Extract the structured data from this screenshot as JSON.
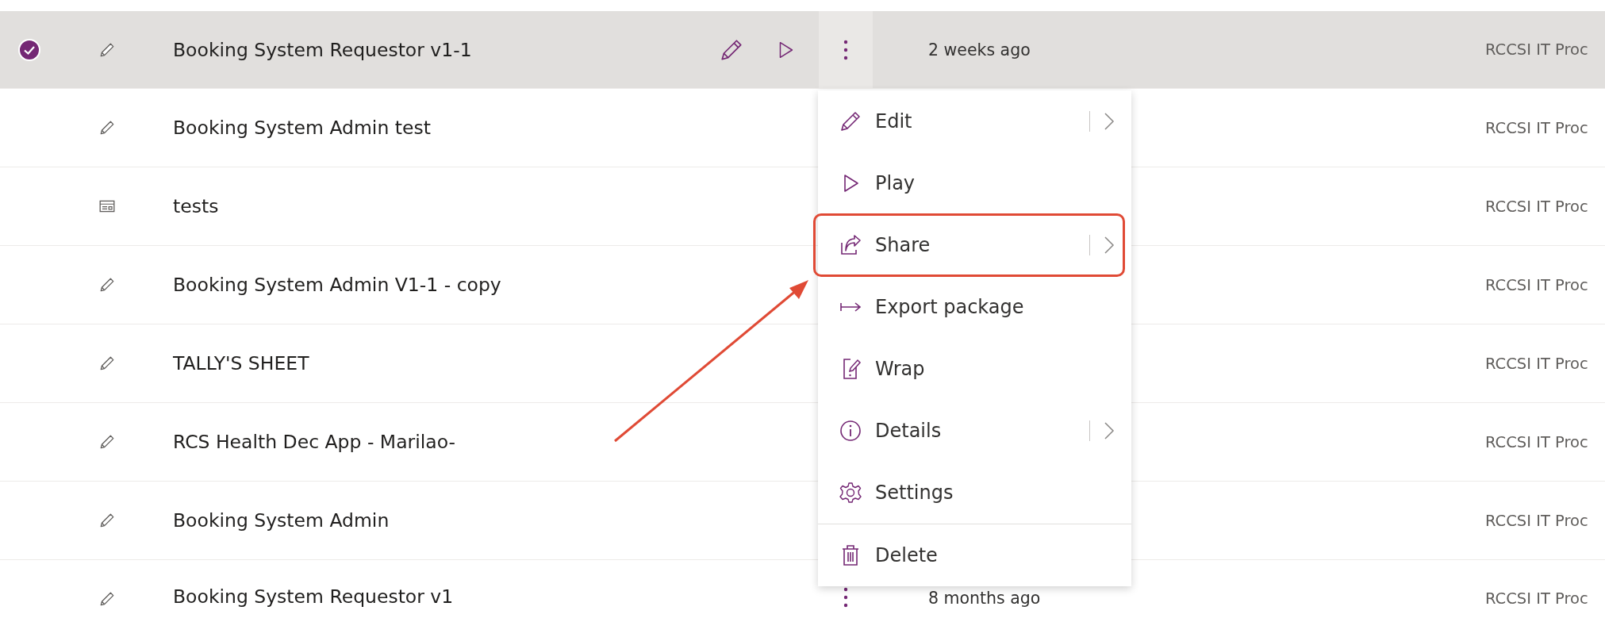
{
  "rows": [
    {
      "name": "Booking System Requestor v1-1",
      "kind": "canvas",
      "selected": true,
      "hovered": true,
      "show_more": true,
      "modified": "2 weeks ago",
      "owner": "RCCSI IT Proc"
    },
    {
      "name": "Booking System Admin test",
      "kind": "canvas",
      "selected": false,
      "hovered": false,
      "show_more": false,
      "owner": "RCCSI IT Proc"
    },
    {
      "name": "tests",
      "kind": "form",
      "selected": false,
      "hovered": false,
      "show_more": false,
      "owner": "RCCSI IT Proc"
    },
    {
      "name": "Booking System Admin V1-1 - copy",
      "kind": "canvas",
      "selected": false,
      "hovered": false,
      "show_more": false,
      "owner": "RCCSI IT Proc"
    },
    {
      "name": "TALLY'S SHEET",
      "kind": "canvas",
      "selected": false,
      "hovered": false,
      "show_more": false,
      "owner": "RCCSI IT Proc"
    },
    {
      "name": "RCS Health Dec App - Marilao-",
      "kind": "canvas",
      "selected": false,
      "hovered": false,
      "show_more": false,
      "owner": "RCCSI IT Proc"
    },
    {
      "name": "Booking System Admin",
      "kind": "canvas",
      "selected": false,
      "hovered": false,
      "show_more": false,
      "owner": "RCCSI IT Proc"
    },
    {
      "name": "Booking System Requestor v1",
      "kind": "canvas",
      "selected": false,
      "hovered": false,
      "show_more": true,
      "modified": "8 months ago",
      "owner": "RCCSI IT Proc"
    }
  ],
  "context_menu": {
    "items": [
      {
        "label": "Edit",
        "kind": "pencil",
        "submenu": true,
        "highlighted": false,
        "divider_before": false
      },
      {
        "label": "Play",
        "kind": "play",
        "submenu": false,
        "highlighted": false,
        "divider_before": false
      },
      {
        "label": "Share",
        "kind": "share",
        "submenu": true,
        "highlighted": true,
        "divider_before": false
      },
      {
        "label": "Export package",
        "kind": "export",
        "submenu": false,
        "highlighted": false,
        "divider_before": false
      },
      {
        "label": "Wrap",
        "kind": "wrap",
        "submenu": false,
        "highlighted": false,
        "divider_before": false
      },
      {
        "label": "Details",
        "kind": "info",
        "submenu": true,
        "highlighted": false,
        "divider_before": false
      },
      {
        "label": "Settings",
        "kind": "gear",
        "submenu": false,
        "highlighted": false,
        "divider_before": false
      },
      {
        "label": "Delete",
        "kind": "trash",
        "submenu": false,
        "highlighted": false,
        "divider_before": true
      }
    ]
  },
  "callout_arrow": true
}
